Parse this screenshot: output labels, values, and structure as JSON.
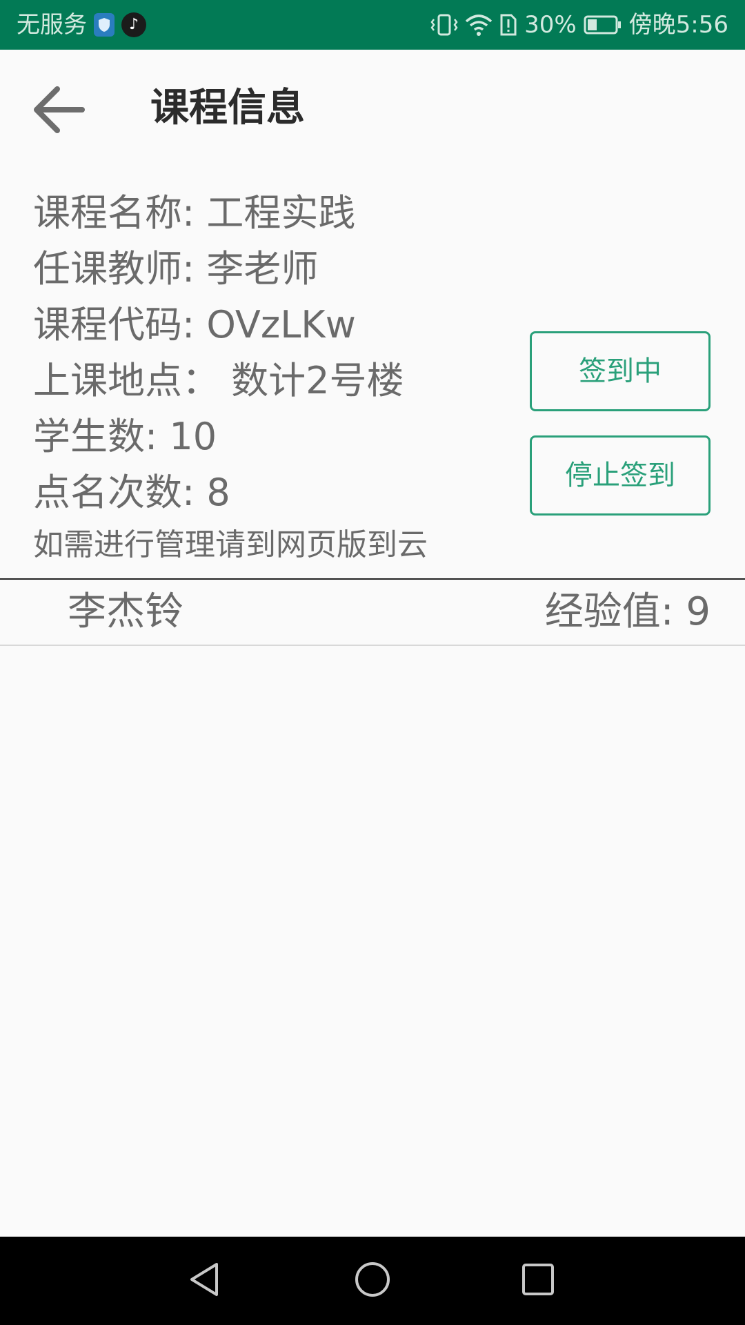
{
  "status_bar": {
    "carrier": "无服务",
    "battery": "30%",
    "time": "傍晚5:56"
  },
  "header": {
    "title": "课程信息"
  },
  "course": {
    "name": "课程名称: 工程实践",
    "teacher": "任课教师: 李老师",
    "code": "课程代码: OVzLKw",
    "location": "上课地点： 数计2号楼",
    "students": "学生数: 10",
    "rollcalls": "点名次数: 8",
    "note": "如需进行管理请到网页版到云"
  },
  "actions": {
    "signing": "签到中",
    "stop": "停止签到"
  },
  "students": [
    {
      "name": "李杰铃",
      "exp": "经验值: 9"
    }
  ],
  "colors": {
    "status_bar": "#027a55",
    "accent": "#2aa07a",
    "text": "#6a6a6a"
  }
}
